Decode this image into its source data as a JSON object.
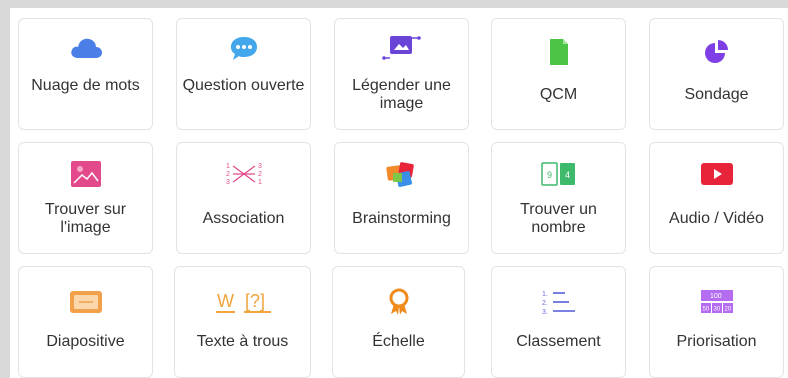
{
  "activities": [
    {
      "label": "Nuage de mots",
      "icon": "cloud-icon",
      "color": "#4a7fe8"
    },
    {
      "label": "Question ouverte",
      "icon": "speech-bubble-icon",
      "color": "#43a7ec"
    },
    {
      "label": "Légender une image",
      "icon": "image-caption-icon",
      "color": "#6a45d8"
    },
    {
      "label": "QCM",
      "icon": "document-icon",
      "color": "#4cc447"
    },
    {
      "label": "Sondage",
      "icon": "pie-chart-icon",
      "color": "#7e3fe4"
    },
    {
      "label": "Trouver sur l'image",
      "icon": "image-icon",
      "color": "#e24a8b"
    },
    {
      "label": "Association",
      "icon": "matching-icon",
      "color": "#e2478b"
    },
    {
      "label": "Brainstorming",
      "icon": "sticky-notes-icon",
      "color": "#f28a2b"
    },
    {
      "label": "Trouver un nombre",
      "icon": "number-cards-icon",
      "color": "#3fb96b"
    },
    {
      "label": "Audio / Vidéo",
      "icon": "play-icon",
      "color": "#e8243a"
    },
    {
      "label": "Diapositive",
      "icon": "slide-icon",
      "color": "#f2a14a"
    },
    {
      "label": "Texte à trous",
      "icon": "fill-blank-icon",
      "color": "#f0a43c"
    },
    {
      "label": "Échelle",
      "icon": "award-ribbon-icon",
      "color": "#f08a1c"
    },
    {
      "label": "Classement",
      "icon": "ordered-list-icon",
      "color": "#6a6fe0"
    },
    {
      "label": "Priorisation",
      "icon": "priority-points-icon",
      "color": "#b46df0"
    }
  ],
  "fill_blank_glyphs": {
    "letter": "W",
    "bracket": "[?]"
  },
  "priority_points": {
    "top": "100",
    "cells": [
      "50",
      "30",
      "20"
    ]
  },
  "number_cards": [
    "9",
    "4"
  ],
  "matching_numbers": {
    "left": [
      "1",
      "2",
      "3"
    ],
    "right": [
      "3",
      "2",
      "1"
    ]
  },
  "list_numbers": [
    "1.",
    "2.",
    "3."
  ]
}
